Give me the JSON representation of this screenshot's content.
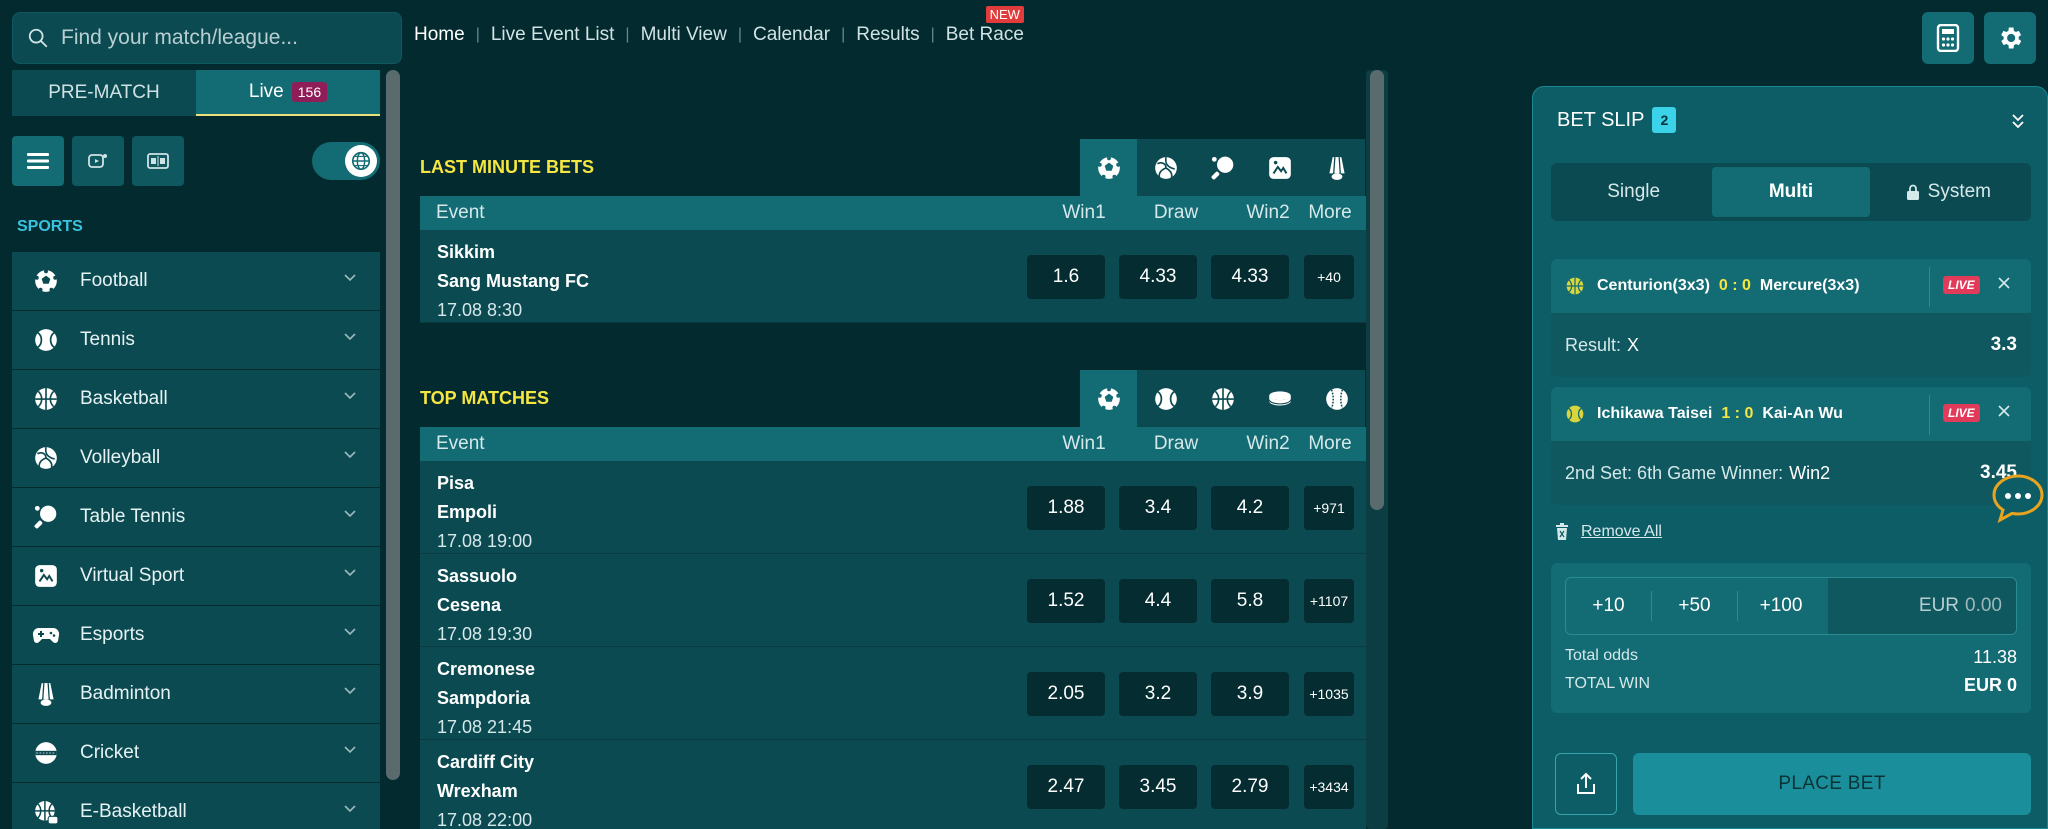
{
  "search": {
    "placeholder": "Find your match/league..."
  },
  "topnav": [
    {
      "label": "Home",
      "active": true
    },
    {
      "label": "Live Event List"
    },
    {
      "label": "Multi View"
    },
    {
      "label": "Calendar"
    },
    {
      "label": "Results"
    },
    {
      "label": "Bet Race",
      "badge": "NEW"
    }
  ],
  "sidebar": {
    "tabs": [
      {
        "label": "PRE-MATCH"
      },
      {
        "label": "Live",
        "count": "156"
      }
    ],
    "sports_label": "SPORTS",
    "sports": [
      {
        "label": "Football",
        "icon": "soccer-ball-icon"
      },
      {
        "label": "Tennis",
        "icon": "tennis-ball-icon"
      },
      {
        "label": "Basketball",
        "icon": "basketball-icon"
      },
      {
        "label": "Volleyball",
        "icon": "volleyball-icon"
      },
      {
        "label": "Table Tennis",
        "icon": "table-tennis-icon"
      },
      {
        "label": "Virtual Sport",
        "icon": "virtual-sport-icon"
      },
      {
        "label": "Esports",
        "icon": "gamepad-icon"
      },
      {
        "label": "Badminton",
        "icon": "shuttlecock-icon"
      },
      {
        "label": "Cricket",
        "icon": "cricket-ball-icon"
      },
      {
        "label": "E-Basketball",
        "icon": "e-basketball-icon"
      }
    ]
  },
  "table_headers": {
    "event": "Event",
    "win1": "Win1",
    "draw": "Draw",
    "win2": "Win2",
    "more": "More"
  },
  "last_minute": {
    "title": "LAST MINUTE BETS",
    "rows": [
      {
        "team1": "Sikkim",
        "team2": "Sang Mustang FC",
        "date": "17.08 8:30",
        "win1": "1.6",
        "draw": "4.33",
        "win2": "4.33",
        "more": "+40"
      }
    ]
  },
  "top_matches": {
    "title": "TOP MATCHES",
    "rows": [
      {
        "team1": "Pisa",
        "team2": "Empoli",
        "date": "17.08 19:00",
        "win1": "1.88",
        "draw": "3.4",
        "win2": "4.2",
        "more": "+971"
      },
      {
        "team1": "Sassuolo",
        "team2": "Cesena",
        "date": "17.08 19:30",
        "win1": "1.52",
        "draw": "4.4",
        "win2": "5.8",
        "more": "+1107"
      },
      {
        "team1": "Cremonese",
        "team2": "Sampdoria",
        "date": "17.08 21:45",
        "win1": "2.05",
        "draw": "3.2",
        "win2": "3.9",
        "more": "+1035"
      },
      {
        "team1": "Cardiff City",
        "team2": "Wrexham",
        "date": "17.08 22:00",
        "win1": "2.47",
        "draw": "3.45",
        "win2": "2.79",
        "more": "+3434"
      }
    ]
  },
  "betslip": {
    "title": "BET SLIP",
    "count": "2",
    "tabs": [
      {
        "label": "Single"
      },
      {
        "label": "Multi",
        "active": true
      },
      {
        "label": "System"
      }
    ],
    "bets": [
      {
        "team1": "Centurion(3x3)",
        "score": "0 : 0",
        "team2": "Mercure(3x3)",
        "live": "LIVE",
        "market": "Result:",
        "selection": "X",
        "odds": "3.3"
      },
      {
        "team1": "Ichikawa Taisei",
        "score": "1 : 0",
        "team2": "Kai-An Wu",
        "live": "LIVE",
        "market": "2nd Set: 6th Game Winner:",
        "selection": "Win2",
        "odds": "3.45"
      }
    ],
    "remove_all": "Remove All",
    "quick_amounts": [
      "+10",
      "+50",
      "+100"
    ],
    "currency": "EUR",
    "stake_placeholder": "0.00",
    "total_odds_label": "Total odds",
    "total_odds": "11.38",
    "total_win_label": "TOTAL WIN",
    "total_win": "EUR 0",
    "place_bet": "PLACE BET"
  },
  "colors": {
    "accent": "#136b73",
    "title_yellow": "#f5e642",
    "live_red": "#e23b5a",
    "bg": "#032a2e"
  }
}
